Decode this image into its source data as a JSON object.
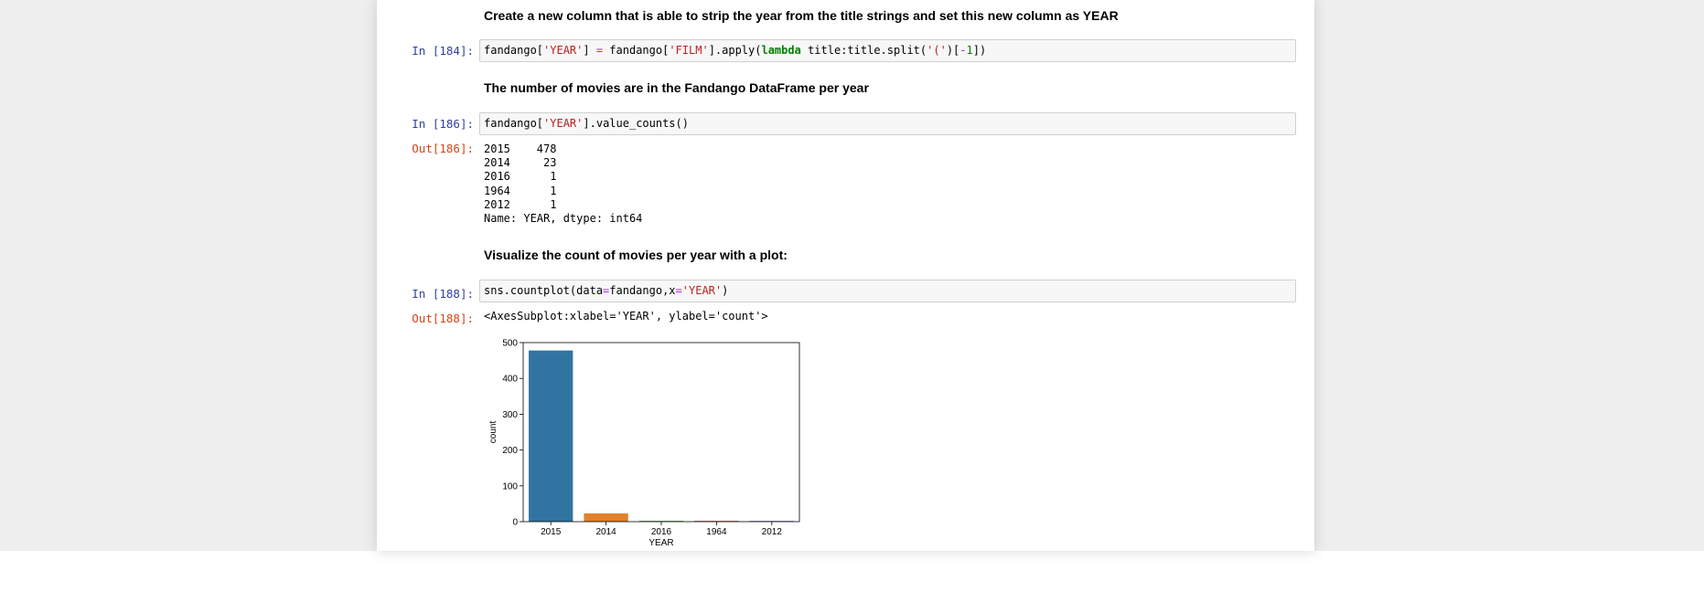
{
  "cells": {
    "md1": "Create a new column that is able to strip the year from the title strings and set this new column as YEAR",
    "in184_prompt": "In [184]:",
    "in184_code": {
      "t1": "fandango[",
      "s1": "'YEAR'",
      "t2": "] ",
      "op1": "=",
      "t3": " fandango[",
      "s2": "'FILM'",
      "t4": "].apply(",
      "kw1": "lambda",
      "t5": " title:title.split(",
      "s3": "'('",
      "t6": ")[",
      "op2": "-",
      "n1": "1",
      "t7": "])"
    },
    "md2": "The number of movies are in the Fandango DataFrame per year",
    "in186_prompt": "In [186]:",
    "in186_code": {
      "t1": "fandango[",
      "s1": "'YEAR'",
      "t2": "].value_counts()"
    },
    "out186_prompt": "Out[186]:",
    "out186_lines": [
      "2015    478",
      "2014     23",
      "2016      1",
      "1964      1",
      "2012      1",
      "Name: YEAR, dtype: int64"
    ],
    "md3": "Visualize the count of movies per year with a plot:",
    "in188_prompt": "In [188]:",
    "in188_code": {
      "t1": "sns.countplot(data",
      "op1": "=",
      "t2": "fandango,x",
      "op2": "=",
      "s1": "'YEAR'",
      "t3": ")"
    },
    "out188_prompt": "Out[188]:",
    "out188_text": "<AxesSubplot:xlabel='YEAR', ylabel='count'>"
  },
  "chart_data": {
    "type": "bar",
    "categories": [
      "2015",
      "2014",
      "2016",
      "1964",
      "2012"
    ],
    "values": [
      478,
      23,
      1,
      1,
      1
    ],
    "colors": [
      "#3274a1",
      "#e1812c",
      "#3a923a",
      "#c03d3e",
      "#9372b2"
    ],
    "title": "",
    "xlabel": "YEAR",
    "ylabel": "count",
    "ylim": [
      0,
      500
    ],
    "yticks": [
      "0",
      "100",
      "200",
      "300",
      "400",
      "500"
    ],
    "grid": false
  }
}
